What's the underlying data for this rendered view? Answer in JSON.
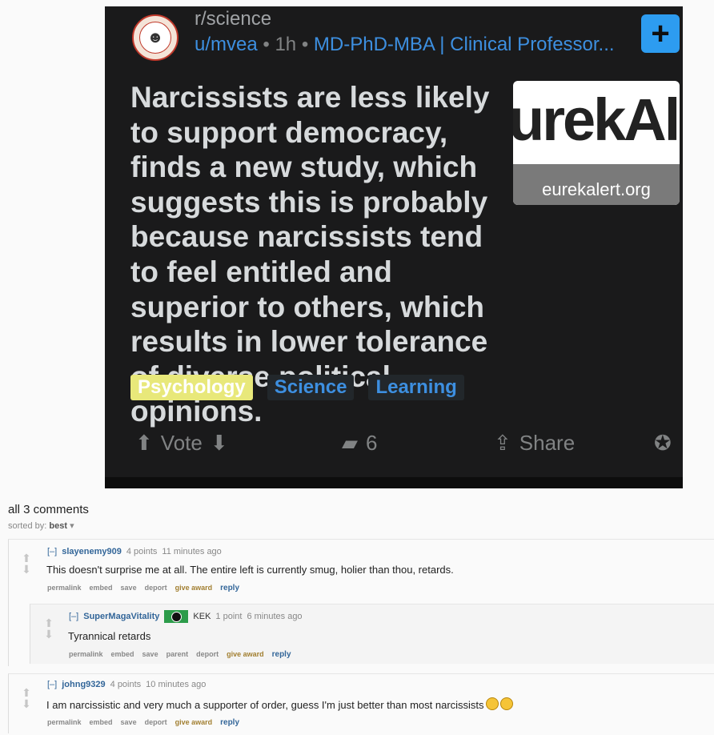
{
  "post": {
    "subreddit": "r/science",
    "author": "u/mvea",
    "age": "1h",
    "author_flair": "MD-PhD-MBA | Clinical Professor...",
    "join_icon": "plus-icon",
    "title": "Narcissists are less likely to support democracy, finds a new study, which suggests this is probably because narcissists tend to feel entitled and superior to others, which results in lower tolerance of diverse political opinions.",
    "thumbnail": {
      "logo_text": "urekAl",
      "domain": "eurekalert.org"
    },
    "tags": [
      "Psychology",
      "Science",
      "Learning"
    ],
    "actions": {
      "vote_label": "Vote",
      "comment_count": "6",
      "share_label": "Share"
    }
  },
  "comments_header": {
    "count_label": "all 3 comments",
    "sorted_label": "sorted by:",
    "sort_value": "best"
  },
  "comments": [
    {
      "expand": "[–]",
      "author": "slayenemy909",
      "score": "4 points",
      "age": "11 minutes ago",
      "body": "This doesn't surprise me at all. The entire left is currently smug, holier than thou, retards.",
      "buttons": [
        "permalink",
        "embed",
        "save",
        "deport",
        "give award",
        "reply"
      ]
    },
    {
      "expand": "[–]",
      "author": "SuperMagaVitality",
      "flair": "KEK",
      "score": "1 point",
      "age": "6 minutes ago",
      "body": "Tyrannical retards",
      "buttons": [
        "permalink",
        "embed",
        "save",
        "parent",
        "deport",
        "give award",
        "reply"
      ]
    },
    {
      "expand": "[–]",
      "author": "johng9329",
      "score": "4 points",
      "age": "10 minutes ago",
      "body": "I am narcissistic and very much a supporter of order, guess I'm just better than most narcissists",
      "buttons": [
        "permalink",
        "embed",
        "save",
        "deport",
        "give award",
        "reply"
      ]
    }
  ]
}
